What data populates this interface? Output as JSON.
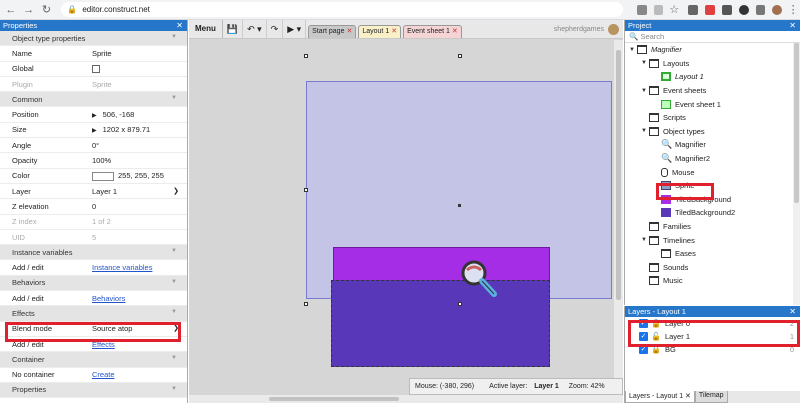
{
  "browser": {
    "url": "editor.construct.net"
  },
  "properties": {
    "title": "Properties",
    "sections": {
      "object_type": "Object type properties",
      "common": "Common",
      "instance_variables": "Instance variables",
      "behaviors": "Behaviors",
      "effects": "Effects",
      "container": "Container",
      "properties": "Properties"
    },
    "rows": {
      "name": {
        "k": "Name",
        "v": "Sprite"
      },
      "global": {
        "k": "Global"
      },
      "plugin": {
        "k": "Plugin",
        "v": "Sprite"
      },
      "position": {
        "k": "Position",
        "v": "506, -168"
      },
      "size": {
        "k": "Size",
        "v": "1202 x 879.71"
      },
      "angle": {
        "k": "Angle",
        "v": "0°"
      },
      "opacity": {
        "k": "Opacity",
        "v": "100%"
      },
      "color": {
        "k": "Color",
        "v": "255, 255, 255"
      },
      "layer": {
        "k": "Layer",
        "v": "Layer 1"
      },
      "zelev": {
        "k": "Z elevation",
        "v": "0"
      },
      "zindex": {
        "k": "Z index",
        "v": "1 of 2"
      },
      "uid": {
        "k": "UID",
        "v": "5"
      },
      "iv_add": {
        "k": "Add / edit",
        "v": "Instance variables"
      },
      "beh_add": {
        "k": "Add / edit",
        "v": "Behaviors"
      },
      "blend": {
        "k": "Blend mode",
        "v": "Source atop"
      },
      "eff_add": {
        "k": "Add / edit",
        "v": "Effects"
      },
      "container": {
        "k": "No container",
        "v": "Create"
      }
    }
  },
  "toolbar": {
    "menu": "Menu",
    "tabs": [
      "Start page",
      "Layout 1",
      "Event sheet 1"
    ],
    "user": "shepherdgames"
  },
  "status": {
    "mouse": "Mouse: (-380, 296)",
    "layer_label": "Active layer:",
    "layer": "Layer 1",
    "zoom": "Zoom: 42%"
  },
  "project": {
    "title": "Project",
    "search_placeholder": "Search",
    "tree": {
      "root": "Magnifier",
      "layouts": "Layouts",
      "layout1": "Layout 1",
      "event_sheets": "Event sheets",
      "event_sheet1": "Event sheet 1",
      "scripts": "Scripts",
      "object_types": "Object types",
      "magnifier": "Magnifier",
      "magnifier2": "Magnifier2",
      "mouse": "Mouse",
      "sprite": "Sprite",
      "tiled1": "TiledBackground",
      "tiled2": "TiledBackground2",
      "families": "Families",
      "timelines": "Timelines",
      "eases": "Eases",
      "sounds": "Sounds",
      "music": "Music"
    }
  },
  "layers": {
    "title": "Layers - Layout 1",
    "rows": [
      {
        "name": "Layer 0",
        "num": "2"
      },
      {
        "name": "Layer 1",
        "num": "1"
      },
      {
        "name": "BG",
        "num": "0"
      }
    ],
    "tabs": [
      "Layers - Layout 1",
      "Tilemap"
    ]
  },
  "colors": {
    "accent": "#2677c9",
    "highlight": "#e0202c",
    "tiled1": "#a52de6",
    "tiled2": "#5838b8"
  }
}
